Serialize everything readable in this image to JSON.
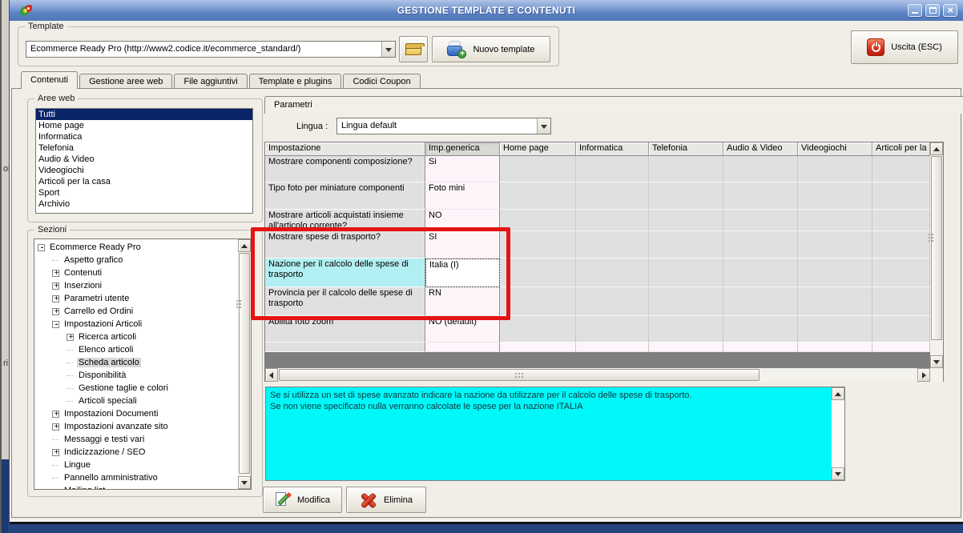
{
  "window": {
    "title": "GESTIONE TEMPLATE E CONTENUTI"
  },
  "template_box": {
    "legend": "Template",
    "combo_value": "Ecommerce Ready Pro (http://www2.codice.it/ecommerce_standard/)",
    "new_template_label": "Nuovo template"
  },
  "exit_button_label": "Uscita (ESC)",
  "tabs": [
    {
      "label": "Contenuti",
      "active": true
    },
    {
      "label": "Gestione aree web"
    },
    {
      "label": "File aggiuntivi"
    },
    {
      "label": "Template e plugins"
    },
    {
      "label": "Codici Coupon"
    }
  ],
  "aree_web": {
    "legend": "Aree web",
    "items": [
      {
        "label": "Tutti",
        "selected": true
      },
      {
        "label": "Home page"
      },
      {
        "label": "Informatica"
      },
      {
        "label": "Telefonia"
      },
      {
        "label": "Audio & Video"
      },
      {
        "label": "Videogiochi"
      },
      {
        "label": "Articoli per la casa"
      },
      {
        "label": "Sport"
      },
      {
        "label": "Archivio"
      }
    ]
  },
  "sezioni": {
    "legend": "Sezioni",
    "tree": [
      {
        "label": "Ecommerce Ready Pro",
        "level": 0,
        "state": "minus"
      },
      {
        "label": "Aspetto grafico",
        "level": 1,
        "state": "leaf"
      },
      {
        "label": "Contenuti",
        "level": 1,
        "state": "plus"
      },
      {
        "label": "Inserzioni",
        "level": 1,
        "state": "plus"
      },
      {
        "label": "Parametri utente",
        "level": 1,
        "state": "plus"
      },
      {
        "label": "Carrello ed Ordini",
        "level": 1,
        "state": "plus"
      },
      {
        "label": "Impostazioni Articoli",
        "level": 1,
        "state": "minus"
      },
      {
        "label": "Ricerca articoli",
        "level": 2,
        "state": "plus"
      },
      {
        "label": "Elenco articoli",
        "level": 2,
        "state": "leaf"
      },
      {
        "label": "Scheda articolo",
        "level": 2,
        "state": "leaf",
        "selected": true
      },
      {
        "label": "Disponibilità",
        "level": 2,
        "state": "leaf"
      },
      {
        "label": "Gestione taglie e colori",
        "level": 2,
        "state": "leaf"
      },
      {
        "label": "Articoli speciali",
        "level": 2,
        "state": "leaf"
      },
      {
        "label": "Impostazioni Documenti",
        "level": 1,
        "state": "plus"
      },
      {
        "label": "Impostazioni avanzate sito",
        "level": 1,
        "state": "plus"
      },
      {
        "label": "Messaggi e testi vari",
        "level": 1,
        "state": "leaf"
      },
      {
        "label": "Indicizzazione / SEO",
        "level": 1,
        "state": "plus"
      },
      {
        "label": "Lingue",
        "level": 1,
        "state": "leaf"
      },
      {
        "label": "Pannello amministrativo",
        "level": 1,
        "state": "leaf"
      },
      {
        "label": "Mailing list",
        "level": 1,
        "state": "leaf"
      }
    ]
  },
  "parametri": {
    "tab_label": "Parametri",
    "lingua_label": "Lingua :",
    "lingua_value": "Lingua default"
  },
  "grid": {
    "columns": [
      "Impostazione",
      "Imp.generica",
      "Home page",
      "Informatica",
      "Telefonia",
      "Audio & Video",
      "Videogiochi",
      "Articoli per la ca"
    ],
    "rows": [
      {
        "label": "Mostrare componenti composizione?",
        "value": "Si"
      },
      {
        "label": "Tipo foto per miniature componenti",
        "value": "Foto mini"
      },
      {
        "label": "Mostrare articoli acquistati insieme all'articolo corrente?",
        "value": "NO"
      },
      {
        "label": "Mostrare spese di trasporto?",
        "value": "SI"
      },
      {
        "label": "Nazione per il calcolo delle spese di trasporto",
        "value": "Italia (I)",
        "selected": true
      },
      {
        "label": "Provincia per il calcolo delle spese di trasporto",
        "value": "RN"
      },
      {
        "label": "Abilita foto zoom",
        "value": "NO (default)"
      },
      {
        "label": "",
        "value": ""
      }
    ]
  },
  "info_box": {
    "line1": "Se si utilizza un set di spese avanzato indicare la nazione da utilizzare per il calcolo delle spese di trasporto.",
    "line2": "Se non viene specificato nulla verranno calcolate le spese per la nazione ITALIA"
  },
  "actions": {
    "modifica": "Modifica",
    "elimina": "Elimina"
  },
  "back_window_fragments": {
    "f1": "ol",
    "f2": "ri"
  },
  "colors": {
    "highlight_red": "#E41414",
    "info_cyan": "#00F8F8",
    "selection_navy": "#0A246A",
    "selected_cell_cyan": "#B2EFF2",
    "titlebar_blue": "#6689C7"
  }
}
